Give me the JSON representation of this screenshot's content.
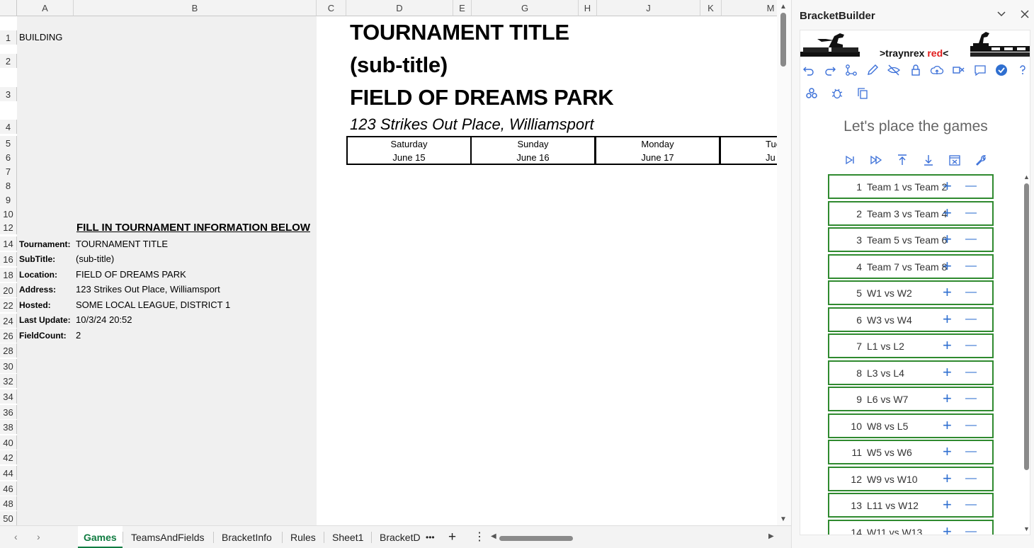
{
  "sheet": {
    "columns": [
      "A",
      "B",
      "C",
      "D",
      "E",
      "G",
      "H",
      "J",
      "K",
      "M"
    ],
    "rows": [
      "1",
      "2",
      "3",
      "4",
      "5",
      "6",
      "7",
      "8",
      "9",
      "10",
      "12",
      "14",
      "16",
      "18",
      "20",
      "22",
      "24",
      "26",
      "28",
      "30",
      "32",
      "34",
      "36",
      "38",
      "40",
      "42",
      "44",
      "46",
      "48",
      "50"
    ],
    "a1": "BUILDING",
    "fill_header": "FILL IN TOURNAMENT INFORMATION BELOW",
    "info": [
      {
        "label": "Tournament:",
        "value": "TOURNAMENT TITLE"
      },
      {
        "label": "SubTitle:",
        "value": "(sub-title)"
      },
      {
        "label": "Location:",
        "value": "FIELD OF DREAMS PARK"
      },
      {
        "label": "Address:",
        "value": "123 Strikes Out Place, Williamsport"
      },
      {
        "label": "Hosted:",
        "value": "SOME LOCAL LEAGUE, DISTRICT 1"
      },
      {
        "label": "Last Update:",
        "value": "10/3/24 20:52"
      },
      {
        "label": "FieldCount:",
        "value": "2"
      }
    ],
    "title": "TOURNAMENT TITLE",
    "subtitle": "(sub-title)",
    "location": "FIELD OF DREAMS PARK",
    "address": "123 Strikes Out Place, Williamsport",
    "days": [
      {
        "day": "Saturday",
        "date": "June 15"
      },
      {
        "day": "Sunday",
        "date": "June 16"
      },
      {
        "day": "Monday",
        "date": "June 17"
      },
      {
        "day": "Tue",
        "date": "Ju"
      }
    ]
  },
  "tabs": [
    "Games",
    "TeamsAndFields",
    "BracketInfo",
    "Rules",
    "Sheet1",
    "BracketD"
  ],
  "tab_more": "•••",
  "tab_add": "+",
  "tab_options": "⋮",
  "pane": {
    "title": "BracketBuilder",
    "brand_prefix": ">traynrex ",
    "brand_red": "red",
    "brand_suffix": "<",
    "heading": "Let's place the games",
    "accent": "#3a6fd8",
    "game_border": "#2f8a2f",
    "games": [
      {
        "num": "1",
        "name": "Team 1 vs Team 2"
      },
      {
        "num": "2",
        "name": "Team 3 vs Team 4"
      },
      {
        "num": "3",
        "name": "Team 5 vs Team 6"
      },
      {
        "num": "4",
        "name": "Team 7 vs Team 8"
      },
      {
        "num": "5",
        "name": "W1 vs W2"
      },
      {
        "num": "6",
        "name": "W3 vs W4"
      },
      {
        "num": "7",
        "name": "L1 vs L2"
      },
      {
        "num": "8",
        "name": "L3 vs L4"
      },
      {
        "num": "9",
        "name": "L6 vs W7"
      },
      {
        "num": "10",
        "name": "W8 vs L5"
      },
      {
        "num": "11",
        "name": "W5 vs W6"
      },
      {
        "num": "12",
        "name": "W9 vs W10"
      },
      {
        "num": "13",
        "name": "L11 vs W12"
      },
      {
        "num": "14",
        "name": "W11 vs W13"
      }
    ],
    "plus": "+",
    "minus": "—"
  }
}
